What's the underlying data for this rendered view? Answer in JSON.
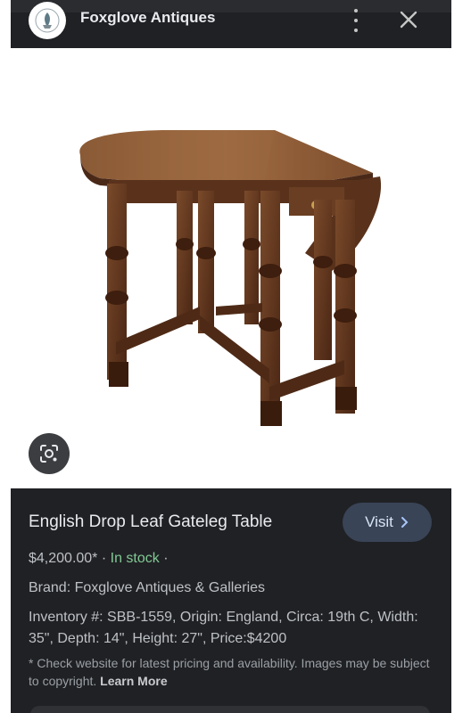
{
  "header": {
    "site_name": "Foxglove Antiques",
    "logo_icon": "foxglove-logo-icon",
    "menu_icon": "more-vert-icon",
    "close_icon": "close-icon"
  },
  "image": {
    "lens_icon": "google-lens-icon"
  },
  "panel": {
    "title": "English Drop Leaf Gateleg Table",
    "visit_label": "Visit",
    "price": "$4,200.00*",
    "separator": "·",
    "stock": "In stock",
    "brand": "Brand: Foxglove Antiques & Galleries",
    "details": "Inventory #: SBB-1559, Origin: England, Circa: 19th C, Width: 35\", Depth: 14\", Height: 27\", Price:$4200",
    "disclaimer": "* Check website for latest pricing and availability. Images may be subject to copyright.",
    "learn_more": "Learn More"
  },
  "colors": {
    "panel_bg": "#202124",
    "visit_bg": "#394457",
    "in_stock": "#81c995"
  }
}
